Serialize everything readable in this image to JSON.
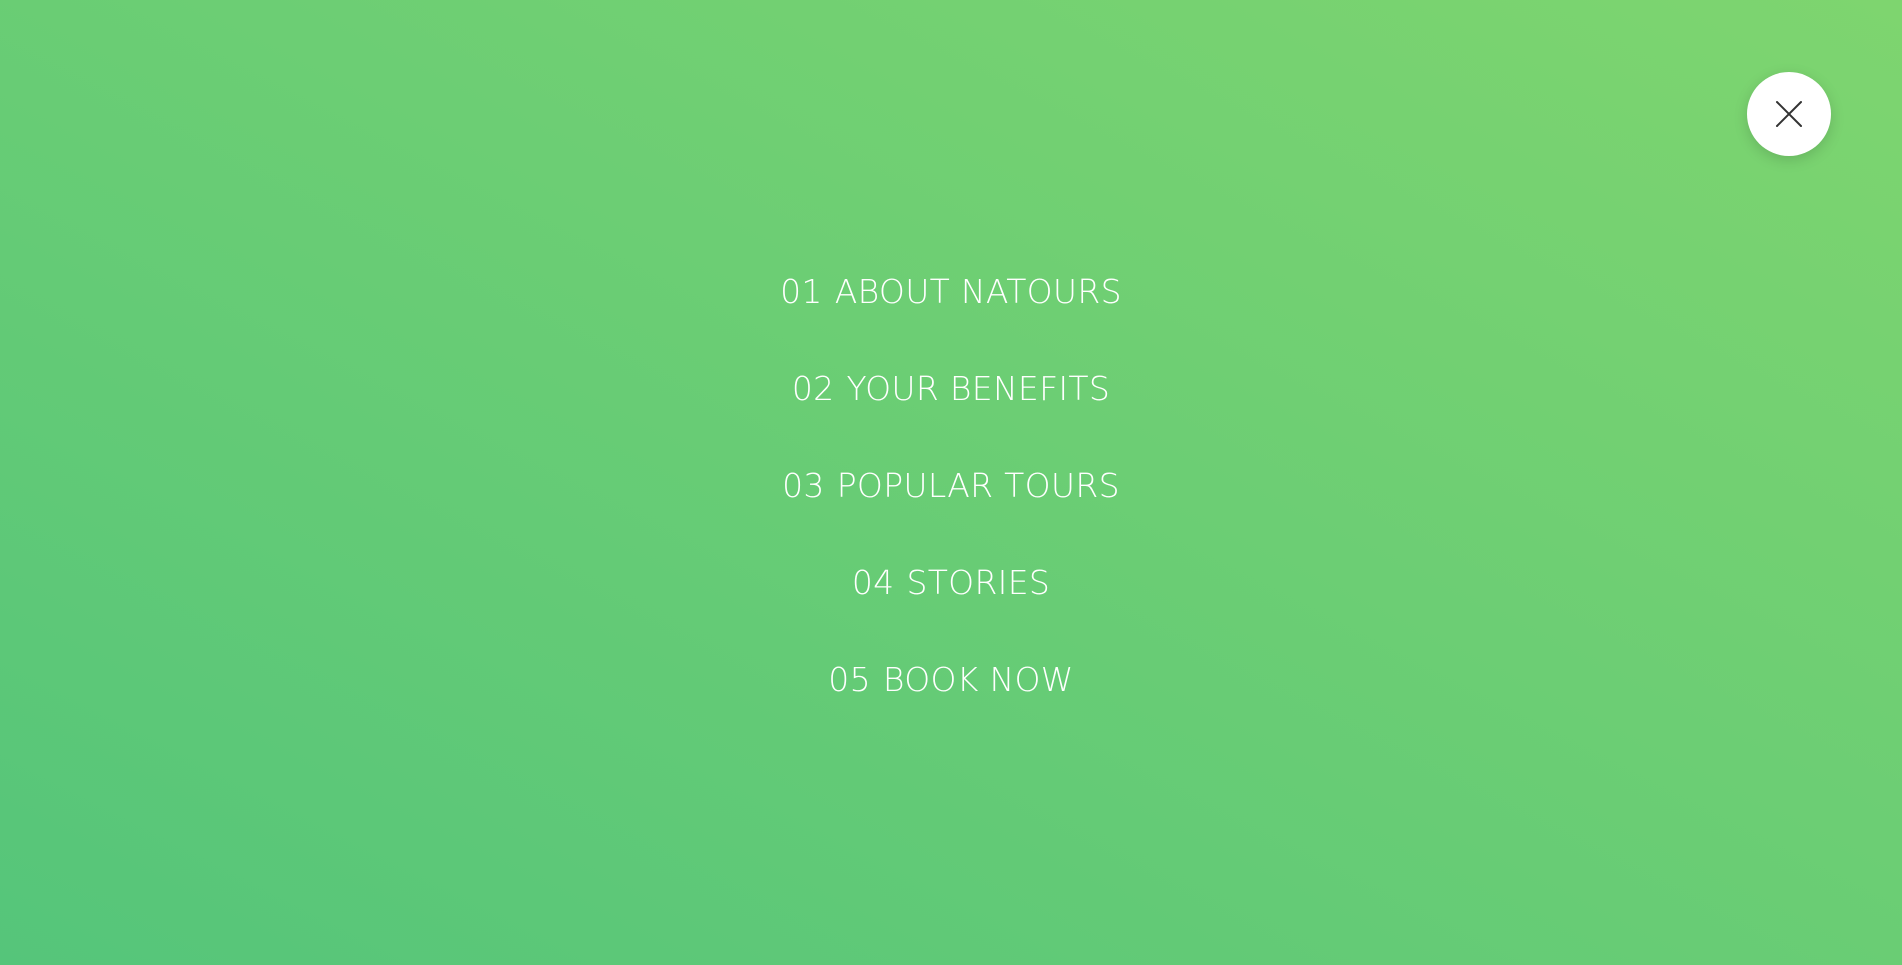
{
  "menu": {
    "background_from": "#55c57a",
    "background_to": "#7ed56f",
    "text_color": "#ffffff",
    "close_icon": "close-icon",
    "items": [
      {
        "num": "01",
        "label": "ABOUT NATOURS"
      },
      {
        "num": "02",
        "label": "YOUR BENEFITS"
      },
      {
        "num": "03",
        "label": "POPULAR TOURS"
      },
      {
        "num": "04",
        "label": "STORIES"
      },
      {
        "num": "05",
        "label": "BOOK NOW"
      }
    ]
  }
}
